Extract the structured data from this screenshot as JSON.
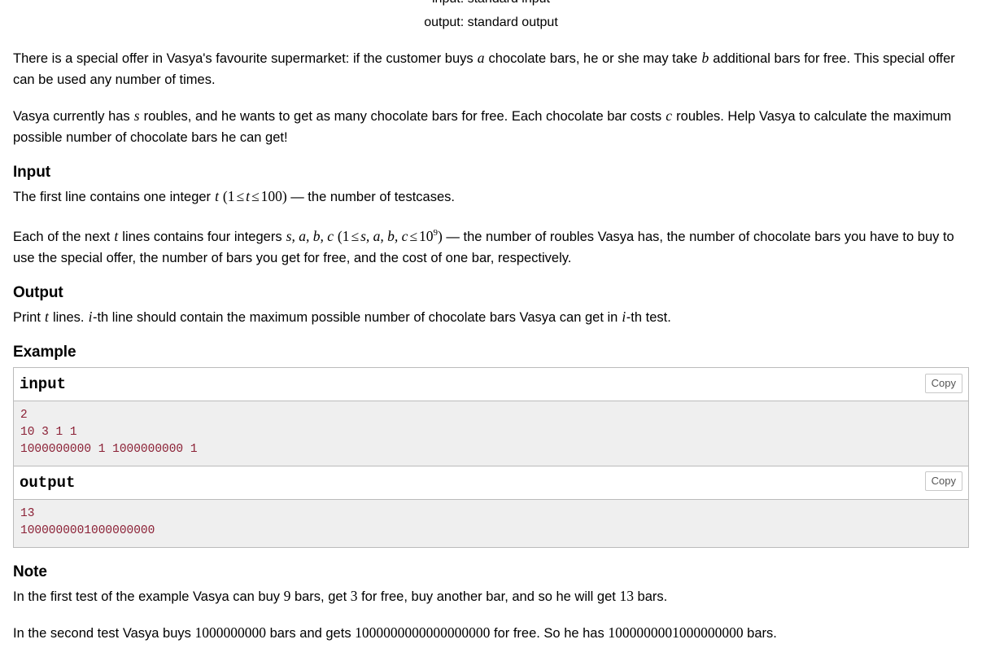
{
  "header": {
    "input_line": "input: standard input",
    "output_line": "output: standard output"
  },
  "statement": {
    "para1_a": "There is a special offer in Vasya's favourite supermarket: if the customer buys ",
    "para1_var_a": "a",
    "para1_b": " chocolate bars, he or she may take ",
    "para1_var_b": "b",
    "para1_c": " additional bars for free. This special offer can be used any number of times.",
    "para2_a": "Vasya currently has ",
    "para2_var_s": "s",
    "para2_b": " roubles, and he wants to get as many chocolate bars for free. Each chocolate bar costs ",
    "para2_var_c": "c",
    "para2_c": " roubles. Help Vasya to calculate the maximum possible number of chocolate bars he can get!"
  },
  "input_section": {
    "heading": "Input",
    "p1_a": "The first line contains one integer ",
    "p1_var_t": "t",
    "p1_constraint_open": "(",
    "p1_c1": "1",
    "p1_le1": "≤",
    "p1_ct": "t",
    "p1_le2": "≤",
    "p1_c100": "100",
    "p1_constraint_close": ")",
    "p1_b": " — the number of testcases.",
    "p2_a": "Each of the next ",
    "p2_var_t": "t",
    "p2_b": " lines contains four integers ",
    "p2_vars": "s, a, b, c",
    "p2_constraint_open": "(",
    "p2_c1": "1",
    "p2_le1": "≤",
    "p2_cvars": "s, a, b, c",
    "p2_le2": "≤",
    "p2_base": "10",
    "p2_exp": "9",
    "p2_constraint_close": ")",
    "p2_c": " — the number of roubles Vasya has, the number of chocolate bars you have to buy to use the special offer, the number of bars you get for free, and the cost of one bar, respectively."
  },
  "output_section": {
    "heading": "Output",
    "p1_a": "Print ",
    "p1_var_t": "t",
    "p1_b": " lines. ",
    "p1_var_i1": "i",
    "p1_c": "-th line should contain the maximum possible number of chocolate bars Vasya can get in ",
    "p1_var_i2": "i",
    "p1_d": "-th test."
  },
  "example_section": {
    "heading": "Example",
    "copy_label": "Copy",
    "blocks": [
      {
        "title": "input",
        "content": "2\n10 3 1 1\n1000000000 1 1000000000 1"
      },
      {
        "title": "output",
        "content": "13\n1000000001000000000"
      }
    ]
  },
  "note_section": {
    "heading": "Note",
    "p1_a": "In the first test of the example Vasya can buy ",
    "p1_n9": "9",
    "p1_b": " bars, get ",
    "p1_n3": "3",
    "p1_c": " for free, buy another bar, and so he will get ",
    "p1_n13": "13",
    "p1_d": " bars.",
    "p2_a": "In the second test Vasya buys ",
    "p2_n1": "1000000000",
    "p2_b": " bars and gets ",
    "p2_n2": "1000000000000000000",
    "p2_c": " for free. So he has ",
    "p2_n3": "1000000001000000000",
    "p2_d": " bars."
  },
  "colors": {
    "code_text": "#8b2035",
    "code_background": "#efefef",
    "border": "#bbbbbb",
    "page_background": "#ffffff"
  }
}
